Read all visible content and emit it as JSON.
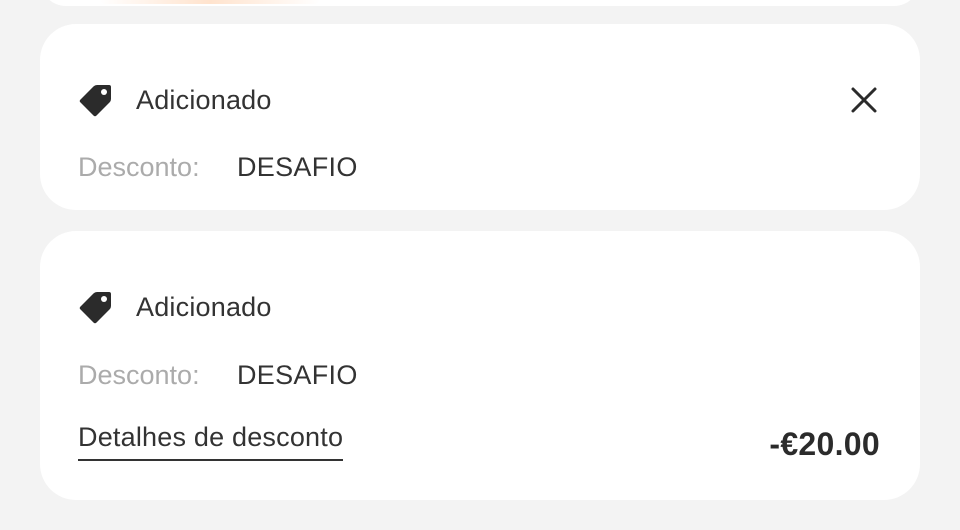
{
  "colors": {
    "background": "#f3f3f3",
    "card": "#ffffff",
    "text_primary": "#333333",
    "text_muted": "#ababab"
  },
  "cards": [
    {
      "status_icon": "tag-icon",
      "status": "Adicionado",
      "close_icon": "close-icon",
      "discount_label": "Desconto:",
      "discount_code": "DESAFIO"
    },
    {
      "status_icon": "tag-icon",
      "status": "Adicionado",
      "discount_label": "Desconto:",
      "discount_code": "DESAFIO",
      "details_link": "Detalhes de desconto",
      "amount": "-€20.00"
    }
  ]
}
